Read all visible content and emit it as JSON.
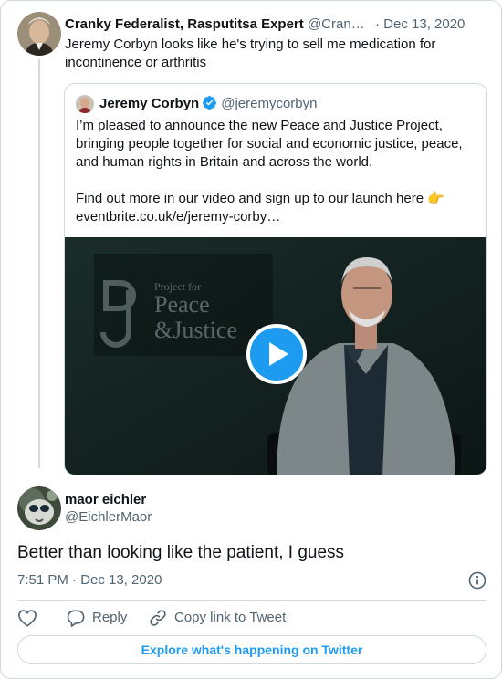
{
  "parent_tweet": {
    "name": "Cranky Federalist, Rasputitsa Expert",
    "handle": "@Cran…",
    "date": "· Dec 13, 2020",
    "text": "Jeremy Corbyn looks like he's trying to sell me medication for incontinence or arthritis"
  },
  "quoted_tweet": {
    "name": "Jeremy Corbyn",
    "handle": "@jeremycorbyn",
    "paragraph_1": "I’m pleased to announce the new Peace and Justice Project, bringing people together for social and economic justice, peace, and human rights in Britain and across the world.",
    "paragraph_2": "Find out more in our video and sign up to our launch here",
    "emoji": "👉",
    "link": "eventbrite.co.uk/e/jeremy-corby…",
    "video_logo_line1": "Project for",
    "video_logo_line2": "Peace",
    "video_logo_line3": "&Justice"
  },
  "reply_tweet": {
    "name": "maor eichler",
    "handle": "@EichlerMaor",
    "text": "Better than looking like the patient, I guess",
    "timestamp": "7:51 PM · Dec 13, 2020"
  },
  "actions": {
    "reply_label": "Reply",
    "copy_label": "Copy link to Tweet"
  },
  "explore_label": "Explore what's happening on Twitter",
  "colors": {
    "accent": "#1d9bf0",
    "text": "#0f1419",
    "secondary": "#536471",
    "border": "#cfd9de"
  }
}
